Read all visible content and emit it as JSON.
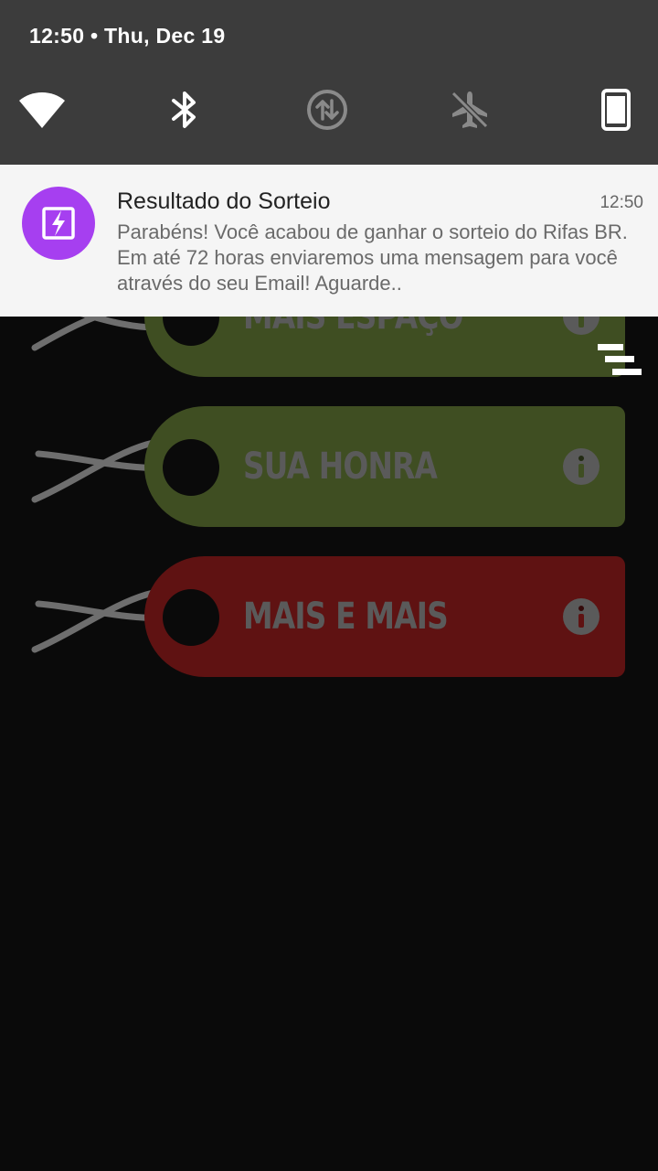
{
  "status_bar": {
    "datetime": "12:50 • Thu, Dec 19"
  },
  "quick_settings": [
    {
      "name": "wifi-icon",
      "state": "on"
    },
    {
      "name": "bluetooth-icon",
      "state": "on"
    },
    {
      "name": "data-transfer-icon",
      "state": "off"
    },
    {
      "name": "airplane-mode-icon",
      "state": "off"
    },
    {
      "name": "device-rotation-icon",
      "state": "on"
    }
  ],
  "notification": {
    "title": "Resultado do Sorteio",
    "time": "12:50",
    "body": "Parabéns! Você acabou de ganhar o sorteio do Rifas BR. Em até 72 horas enviaremos uma mensagem para você através do seu Email! Aguarde..",
    "icon": "lightning-ticket-icon",
    "icon_color": "#a63ff0"
  },
  "app": {
    "tags": [
      {
        "label": "MAIS ESPAÇO",
        "color": "#3f4e22"
      },
      {
        "label": "SUA HONRA",
        "color": "#3f4e22"
      },
      {
        "label": "MAIS E MAIS",
        "color": "#5f1212"
      }
    ],
    "menu_icon": "menu-icon"
  }
}
